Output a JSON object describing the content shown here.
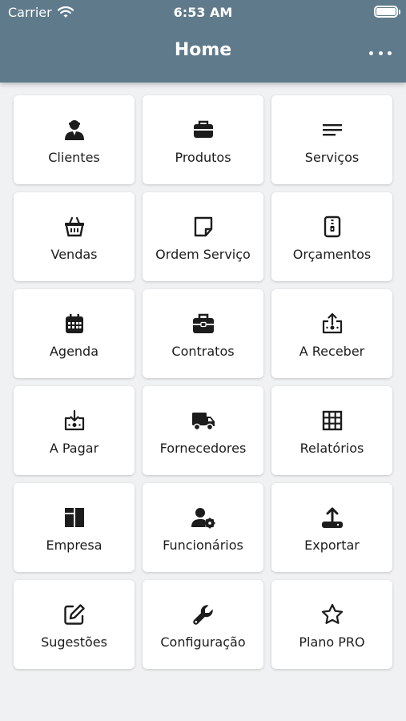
{
  "status_bar": {
    "carrier": "Carrier",
    "time": "6:53 AM"
  },
  "header": {
    "title": "Home",
    "more_icon": "more-horizontal-icon"
  },
  "colors": {
    "header_bg": "#5f7a8b",
    "page_bg": "#f0f1f3",
    "tile_bg": "#ffffff",
    "icon": "#1c1c1c"
  },
  "tiles": [
    {
      "label": "Clientes",
      "icon": "user-person-icon"
    },
    {
      "label": "Produtos",
      "icon": "briefcase-icon"
    },
    {
      "label": "Serviços",
      "icon": "lines-icon"
    },
    {
      "label": "Vendas",
      "icon": "basket-icon"
    },
    {
      "label": "Ordem Serviço",
      "icon": "note-icon"
    },
    {
      "label": "Orçamentos",
      "icon": "zip-file-icon"
    },
    {
      "label": "Agenda",
      "icon": "calendar-icon"
    },
    {
      "label": "Contratos",
      "icon": "toolbox-icon"
    },
    {
      "label": "A Receber",
      "icon": "receive-money-icon"
    },
    {
      "label": "A Pagar",
      "icon": "pay-money-icon"
    },
    {
      "label": "Fornecedores",
      "icon": "truck-icon"
    },
    {
      "label": "Relatórios",
      "icon": "grid-icon"
    },
    {
      "label": "Empresa",
      "icon": "layout-icon"
    },
    {
      "label": "Funcionários",
      "icon": "user-gear-icon"
    },
    {
      "label": "Exportar",
      "icon": "upload-icon"
    },
    {
      "label": "Sugestões",
      "icon": "edit-icon"
    },
    {
      "label": "Configuração",
      "icon": "wrench-icon"
    },
    {
      "label": "Plano PRO",
      "icon": "star-icon"
    }
  ]
}
